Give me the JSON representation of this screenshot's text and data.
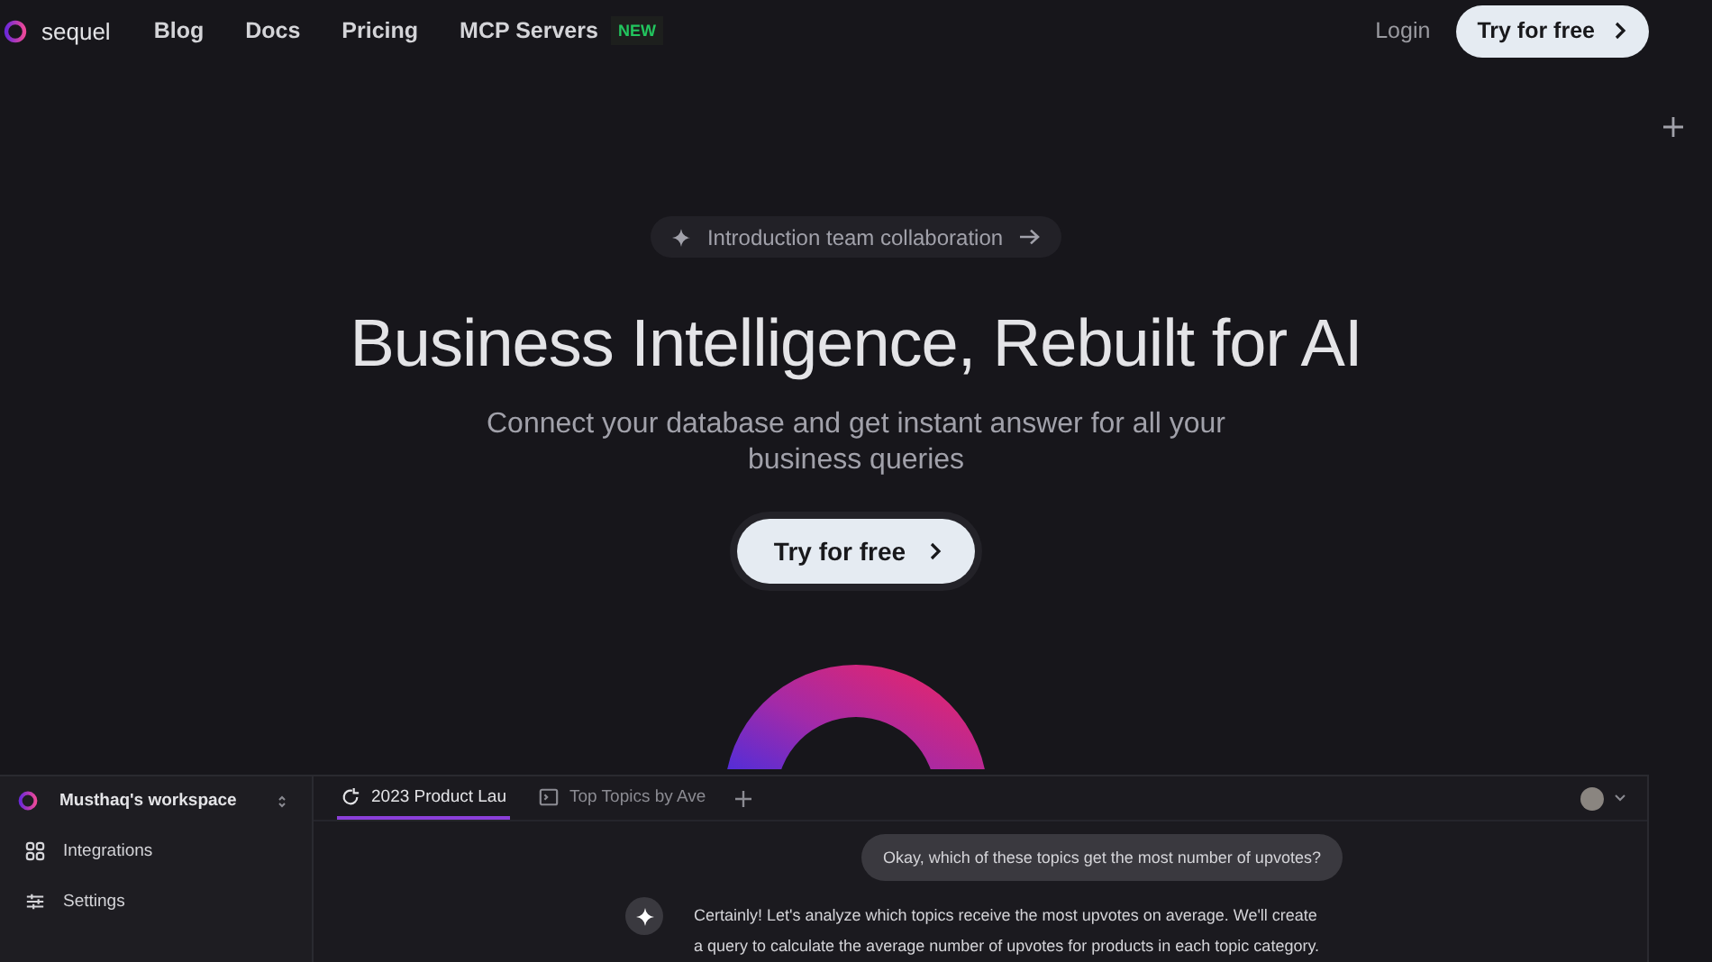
{
  "nav": {
    "brand": "sequel",
    "links": [
      {
        "label": "Blog"
      },
      {
        "label": "Docs"
      },
      {
        "label": "Pricing"
      },
      {
        "label": "MCP Servers",
        "badge": "NEW"
      }
    ],
    "login": "Login",
    "cta": "Try for free"
  },
  "hero": {
    "announcement": "Introduction team collaboration",
    "title": "Business Intelligence, Rebuilt for AI",
    "subtitle": "Connect your database and get instant answer for all your business queries",
    "cta": "Try for free"
  },
  "app": {
    "workspace": "Musthaq's workspace",
    "sidebar": {
      "items": [
        {
          "label": "Integrations",
          "kind": "grid"
        },
        {
          "label": "Settings",
          "kind": "sliders"
        }
      ]
    },
    "tabs": [
      {
        "label": "2023 Product Lau",
        "kind": "chat",
        "selected": true
      },
      {
        "label": "Top Topics by Ave",
        "kind": "query",
        "selected": false
      }
    ],
    "messages": [
      {
        "kind": "question",
        "text": "Okay, which of these topics get the most number of upvotes?"
      },
      {
        "kind": "answer",
        "text": "Certainly! Let's analyze which topics receive the most upvotes on average. We'll create a query to calculate the average number of upvotes for products in each topic category."
      }
    ]
  }
}
